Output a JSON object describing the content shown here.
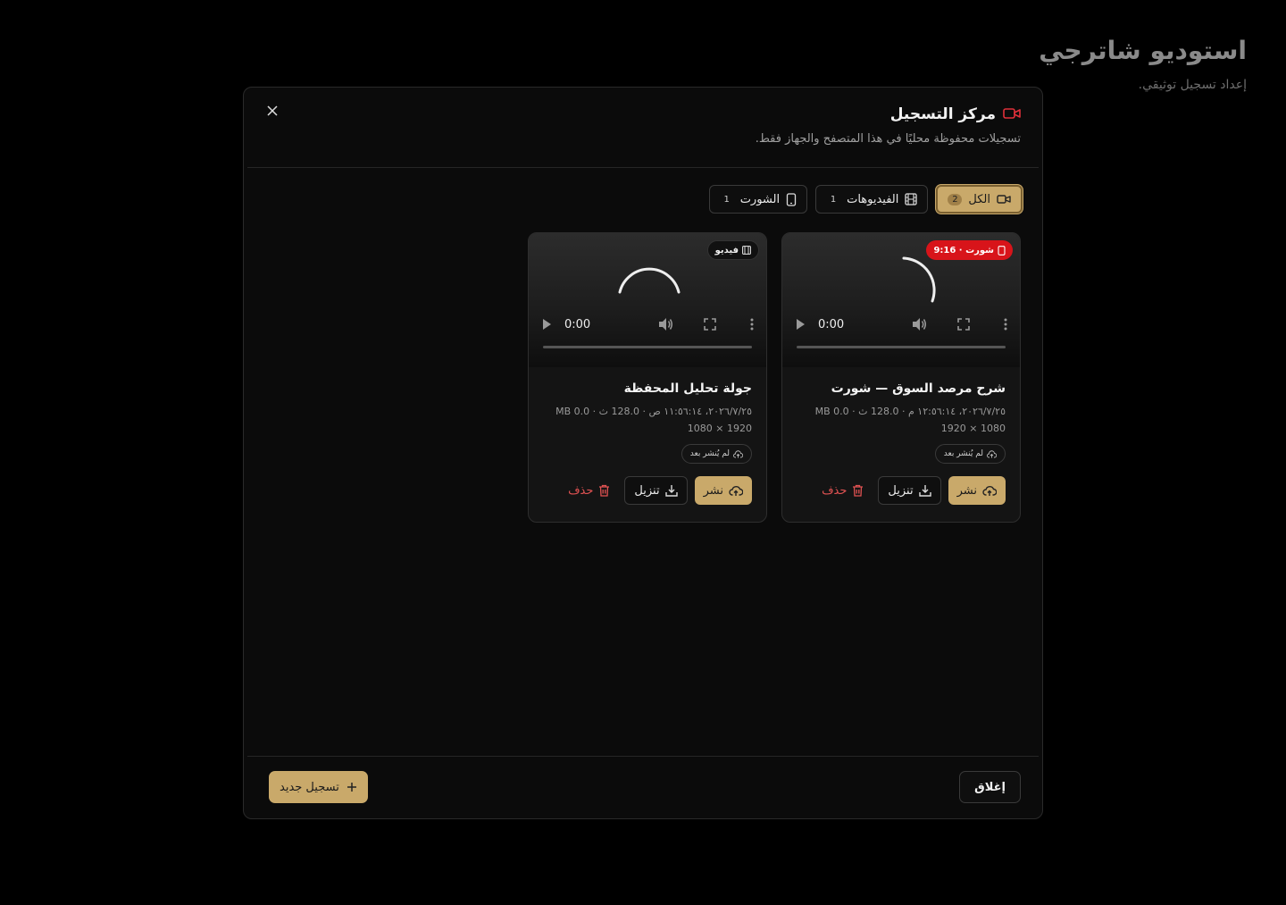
{
  "page": {
    "title": "استوديو شاترجي",
    "subtitle": "إعداد تسجيل توثيقي."
  },
  "modal": {
    "title": "مركز التسجيل",
    "description": "تسجيلات محفوظة محليًا في هذا المتصفح والجهاز فقط.",
    "tabs": [
      {
        "label": "الكل",
        "count": "2",
        "icon": "video-camera-icon",
        "active": true
      },
      {
        "label": "الفيديوهات",
        "count": "1",
        "icon": "film-icon",
        "active": false
      },
      {
        "label": "الشورت",
        "count": "1",
        "icon": "phone-icon",
        "active": false
      }
    ],
    "recordings": [
      {
        "title": "شرح مرصد السوق — شورت",
        "badge": "شورت · 9:16",
        "meta_line1": "٢٠٢٦/٧/٢٥، ١٢:٥٦:١٤ م · 128.0 ث · 0.0 MB",
        "meta_line2": "1080 × 1920",
        "status": "لم يُنشر بعد",
        "time": "0:00",
        "publish": "نشر",
        "download": "تنزيل",
        "delete": "حذف"
      },
      {
        "title": "جولة تحليل المحفظة",
        "badge": "فيديو",
        "meta_line1": "٢٠٢٦/٧/٢٥، ١١:٥٦:١٤ ص · 128.0 ث · 0.0 MB",
        "meta_line2": "1920 × 1080",
        "status": "لم يُنشر بعد",
        "time": "0:00",
        "publish": "نشر",
        "download": "تنزيل",
        "delete": "حذف"
      }
    ],
    "footer": {
      "close": "إغلاق",
      "new_recording": "تسجيل جديد"
    }
  },
  "colors": {
    "accent": "#c9a96a",
    "danger": "#e05252",
    "short_badge": "#d8141a"
  }
}
